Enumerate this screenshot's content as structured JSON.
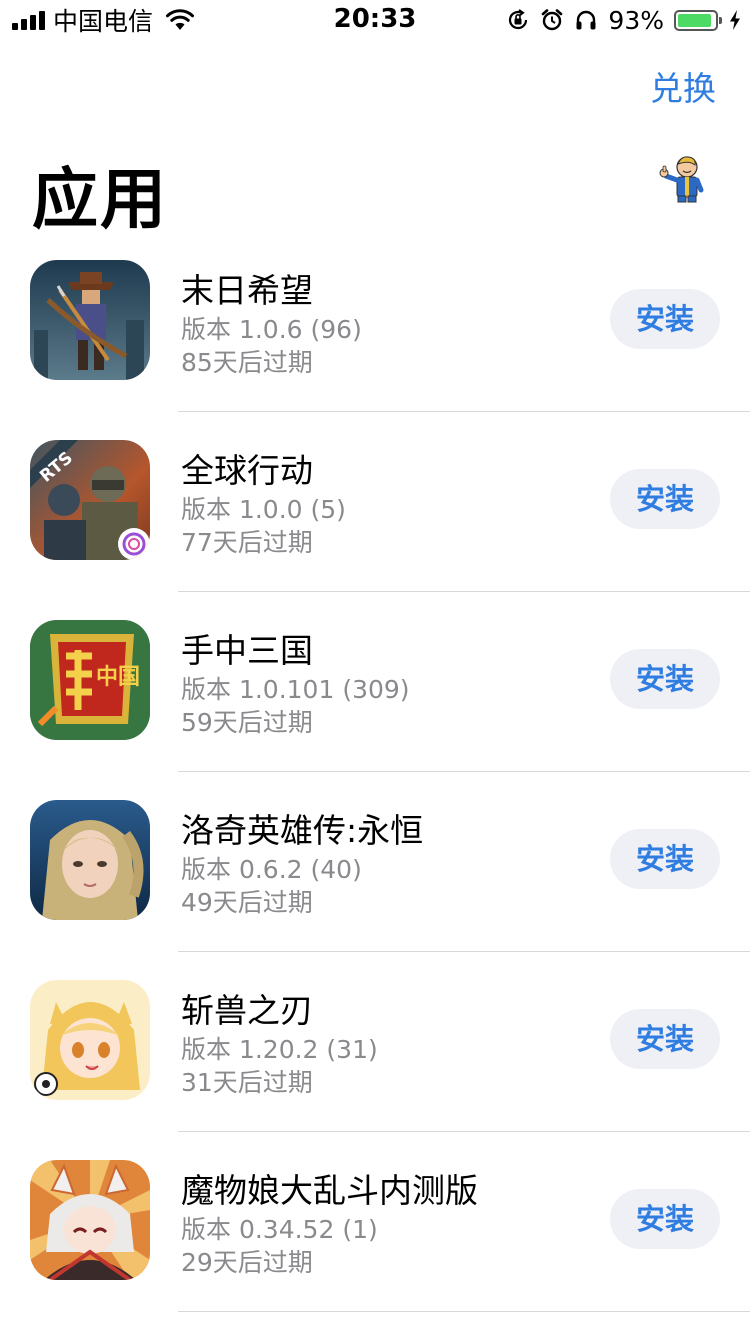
{
  "status_bar": {
    "carrier": "中国电信",
    "time": "20:33",
    "battery_percent": "93%",
    "battery_level": 0.93,
    "battery_color": "#4cd964",
    "icons": [
      "signal-icon",
      "wifi-icon",
      "orientation-lock-icon",
      "alarm-icon",
      "headphones-icon",
      "battery-icon",
      "charging-bolt-icon"
    ]
  },
  "header": {
    "redeem_label": "兑换",
    "title": "应用",
    "avatar_icon": "vault-boy-avatar"
  },
  "colors": {
    "accent": "#2f7de1",
    "secondary_text": "#8a8a8e",
    "button_bg": "#eff0f5",
    "divider": "#d8d8dc"
  },
  "apps": [
    {
      "name": "末日希望",
      "version": "版本 1.0.6 (96)",
      "expiry": "85天后过期",
      "button": "安装",
      "icon": "app-icon-archer"
    },
    {
      "name": "全球行动",
      "version": "版本 1.0.0 (5)",
      "expiry": "77天后过期",
      "button": "安装",
      "icon": "app-icon-soldier",
      "icon_text": "RTS"
    },
    {
      "name": "手中三国",
      "version": "版本 1.0.101 (309)",
      "expiry": "59天后过期",
      "button": "安装",
      "icon": "app-icon-three-kingdoms",
      "icon_text": "中国"
    },
    {
      "name": "洛奇英雄传:永恒",
      "version": "版本 0.6.2 (40)",
      "expiry": "49天后过期",
      "button": "安装",
      "icon": "app-icon-heroine"
    },
    {
      "name": "斩兽之刃",
      "version": "版本 1.20.2 (31)",
      "expiry": "31天后过期",
      "button": "安装",
      "icon": "app-icon-anime-girl"
    },
    {
      "name": "魔物娘大乱斗内测版",
      "version": "版本 0.34.52 (1)",
      "expiry": "29天后过期",
      "button": "安装",
      "icon": "app-icon-fox-girl"
    }
  ]
}
